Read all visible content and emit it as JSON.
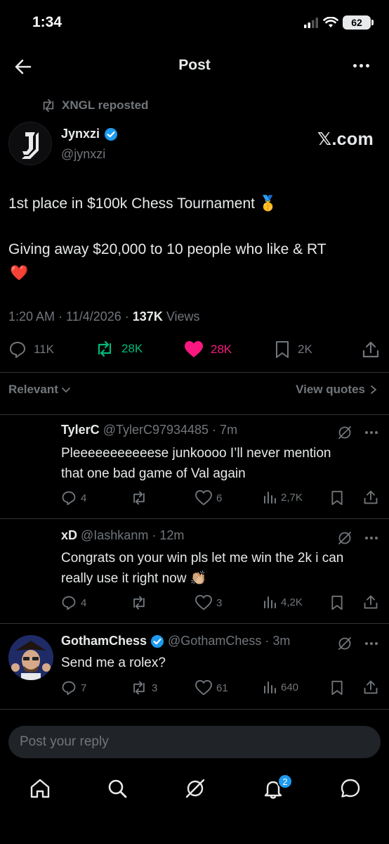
{
  "status_bar": {
    "time": "1:34",
    "battery": "62"
  },
  "header": {
    "title": "Post"
  },
  "repost": {
    "text": "XNGL reposted"
  },
  "author": {
    "name": "Jynxzi",
    "handle": "@jynxzi",
    "verified_color": "#1d9bf0",
    "brand": "𝕏.com"
  },
  "post": {
    "line1": "1st place in $100k Chess Tournament 🥇",
    "line2": "Giving away $20,000 to 10 people who like & RT",
    "line3": "❤️",
    "time": "1:20 AM · 11/4/2026 · ",
    "views_count": "137K",
    "views_label": " Views"
  },
  "actions": {
    "replies": "11K",
    "reposts": "28K",
    "likes": "28K",
    "bookmarks": "2K"
  },
  "colors": {
    "repost_green": "#00ba7c",
    "like_pink": "#f91880",
    "accent_blue": "#1d9bf0"
  },
  "sort": {
    "relevant": "Relevant",
    "view_quotes": "View quotes"
  },
  "replies": [
    {
      "name": "TylerC",
      "handle": "@TylerC97934485",
      "time": "· 7m",
      "line1": "Pleeeeeeeeeeese junkoooo I’ll never mention",
      "line2": "that one bad game of Val again",
      "replies": "4",
      "reposts": "",
      "likes": "6",
      "views": "2,7K"
    },
    {
      "name": "xD",
      "handle": "@Iashkanm",
      "time": "· 12m",
      "line1": "Congrats on your win pls let me win the 2k i can",
      "line2": "really use it right now 👏🏼",
      "replies": "4",
      "reposts": "",
      "likes": "3",
      "views": "4,2K"
    },
    {
      "name": "GothamChess",
      "handle": "@GothamChess",
      "time": "· 3m",
      "line1": "Send me a rolex?",
      "line2": "",
      "replies": "7",
      "reposts": "3",
      "likes": "61",
      "views": "640"
    }
  ],
  "reply_box": {
    "placeholder": "Post your reply"
  },
  "nav": {
    "notifications_badge": "2"
  }
}
